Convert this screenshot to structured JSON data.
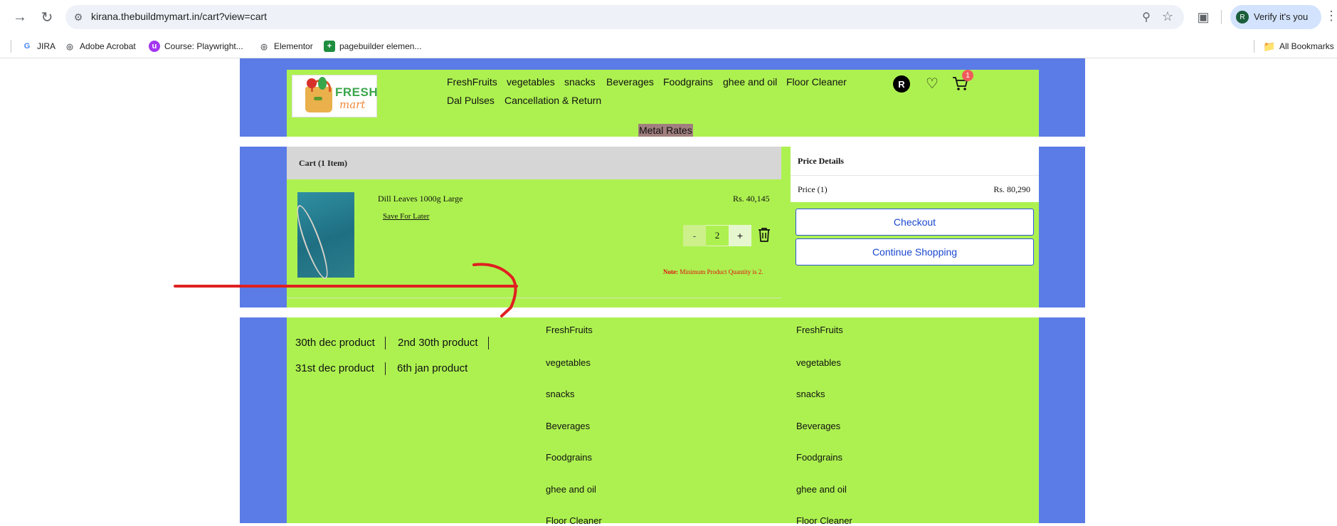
{
  "browser": {
    "url": "kirana.thebuildmymart.in/cart?view=cart",
    "profile_initial": "R",
    "verify_label": "Verify it's you",
    "bookmarks": [
      {
        "label": "JIRA",
        "icon": "G"
      },
      {
        "label": "Adobe Acrobat",
        "icon": "globe"
      },
      {
        "label": "Course: Playwright...",
        "icon": "u"
      },
      {
        "label": "Elementor",
        "icon": "globe"
      },
      {
        "label": "pagebuilder elemen...",
        "icon": "+"
      }
    ],
    "all_bookmarks_label": "All Bookmarks"
  },
  "header": {
    "logo_line1": "FRESH",
    "logo_line2": "mart",
    "nav_row1": [
      "FreshFruits",
      "vegetables",
      "snacks",
      "Beverages",
      "Foodgrains",
      "ghee and oil",
      "Floor Cleaner"
    ],
    "nav_row2": [
      "Dal Pulses",
      "Cancellation & Return"
    ],
    "metal_rates": "Metal Rates",
    "user_initial": "R",
    "cart_count": "1"
  },
  "cart": {
    "title": "Cart (1 Item)",
    "item": {
      "name": "Dill Leaves 1000g Large",
      "price": "Rs. 40,145",
      "save_for_later": "Save For Later",
      "qty_minus": "-",
      "qty": "2",
      "qty_plus": "+",
      "note_label": "Note:",
      "note_text": " Minimum Product Quantity is 2."
    }
  },
  "price_details": {
    "title": "Price Details",
    "price_label": "Price (1)",
    "price_value": "Rs. 80,290",
    "checkout": "Checkout",
    "continue": "Continue Shopping"
  },
  "footer": {
    "links_row1": [
      "30th dec product",
      "2nd 30th product"
    ],
    "links_row2": [
      "31st dec product",
      "6th jan product"
    ],
    "column1": [
      "FreshFruits",
      "vegetables",
      "snacks",
      "Beverages",
      "Foodgrains",
      "ghee and oil",
      "Floor Cleaner"
    ],
    "column2": [
      "FreshFruits",
      "vegetables",
      "snacks",
      "Beverages",
      "Foodgrains",
      "ghee and oil",
      "Floor Cleaner"
    ]
  },
  "colors": {
    "band_blue": "#5b7ce6",
    "lime": "#adf150",
    "annotation_red": "#e02020",
    "button_blue": "#1a47d0"
  }
}
